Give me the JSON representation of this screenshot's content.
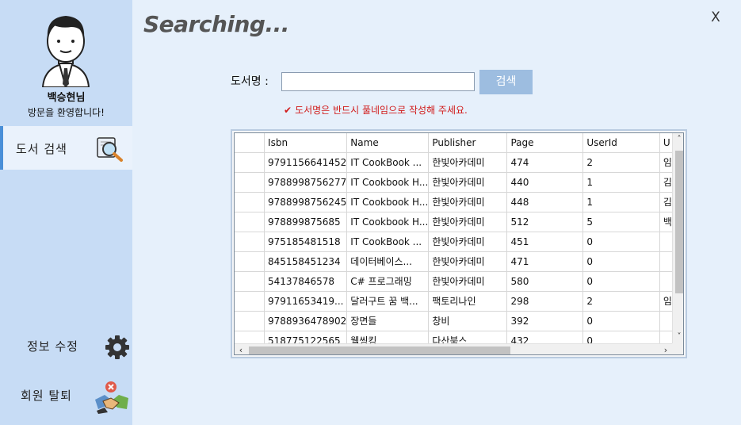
{
  "title": "Searching...",
  "close_label": "X",
  "profile": {
    "name": "백승현님",
    "welcome": "방문을 환영합니다!"
  },
  "nav": {
    "search": "도서 검색",
    "edit": "정보 수정",
    "leave": "회원 탈퇴"
  },
  "search": {
    "label": "도서명 :",
    "value": "",
    "button": "검색",
    "warning": "도서명은 반드시 풀네임으로 작성해 주세요."
  },
  "grid": {
    "columns": [
      "Isbn",
      "Name",
      "Publisher",
      "Page",
      "UserId",
      "U"
    ],
    "rows": [
      [
        "9791156641452",
        "IT CookBook ...",
        "한빛아카데미",
        "474",
        "2",
        "임"
      ],
      [
        "9788998756277",
        "IT Cookbook H...",
        "한빛아카데미",
        "440",
        "1",
        "김"
      ],
      [
        "9788998756245",
        "IT Cookbook H...",
        "한빛아카데미",
        "448",
        "1",
        "김"
      ],
      [
        "978899875685",
        "IT Cookbook H...",
        "한빛아카데미",
        "512",
        "5",
        "백"
      ],
      [
        "975185481518",
        "IT CookBook ...",
        "한빛아카데미",
        "451",
        "0",
        ""
      ],
      [
        "845158451234",
        "데이터베이스...",
        "한빛아카데미",
        "471",
        "0",
        ""
      ],
      [
        "54137846578",
        "C# 프로그래밍",
        "한빛아카데미",
        "580",
        "0",
        ""
      ],
      [
        "97911653419...",
        "달러구트 꿈 백...",
        "팩토리나인",
        "298",
        "2",
        "임"
      ],
      [
        "9788936478902",
        "장면들",
        "창비",
        "392",
        "0",
        ""
      ],
      [
        "518775122565",
        "웰씽킹",
        "다산북스",
        "432",
        "0",
        ""
      ]
    ]
  },
  "colors": {
    "sidebar": "#c7dcf5",
    "background": "#e6f0fb",
    "accent": "#4a8fd8",
    "button": "#9dbde0",
    "warning": "#d11a1a"
  },
  "icons": {
    "avatar": "avatar-icon",
    "search": "magnifier-icon",
    "edit": "gear-icon",
    "leave": "handshake-icon",
    "warning": "check-icon"
  }
}
